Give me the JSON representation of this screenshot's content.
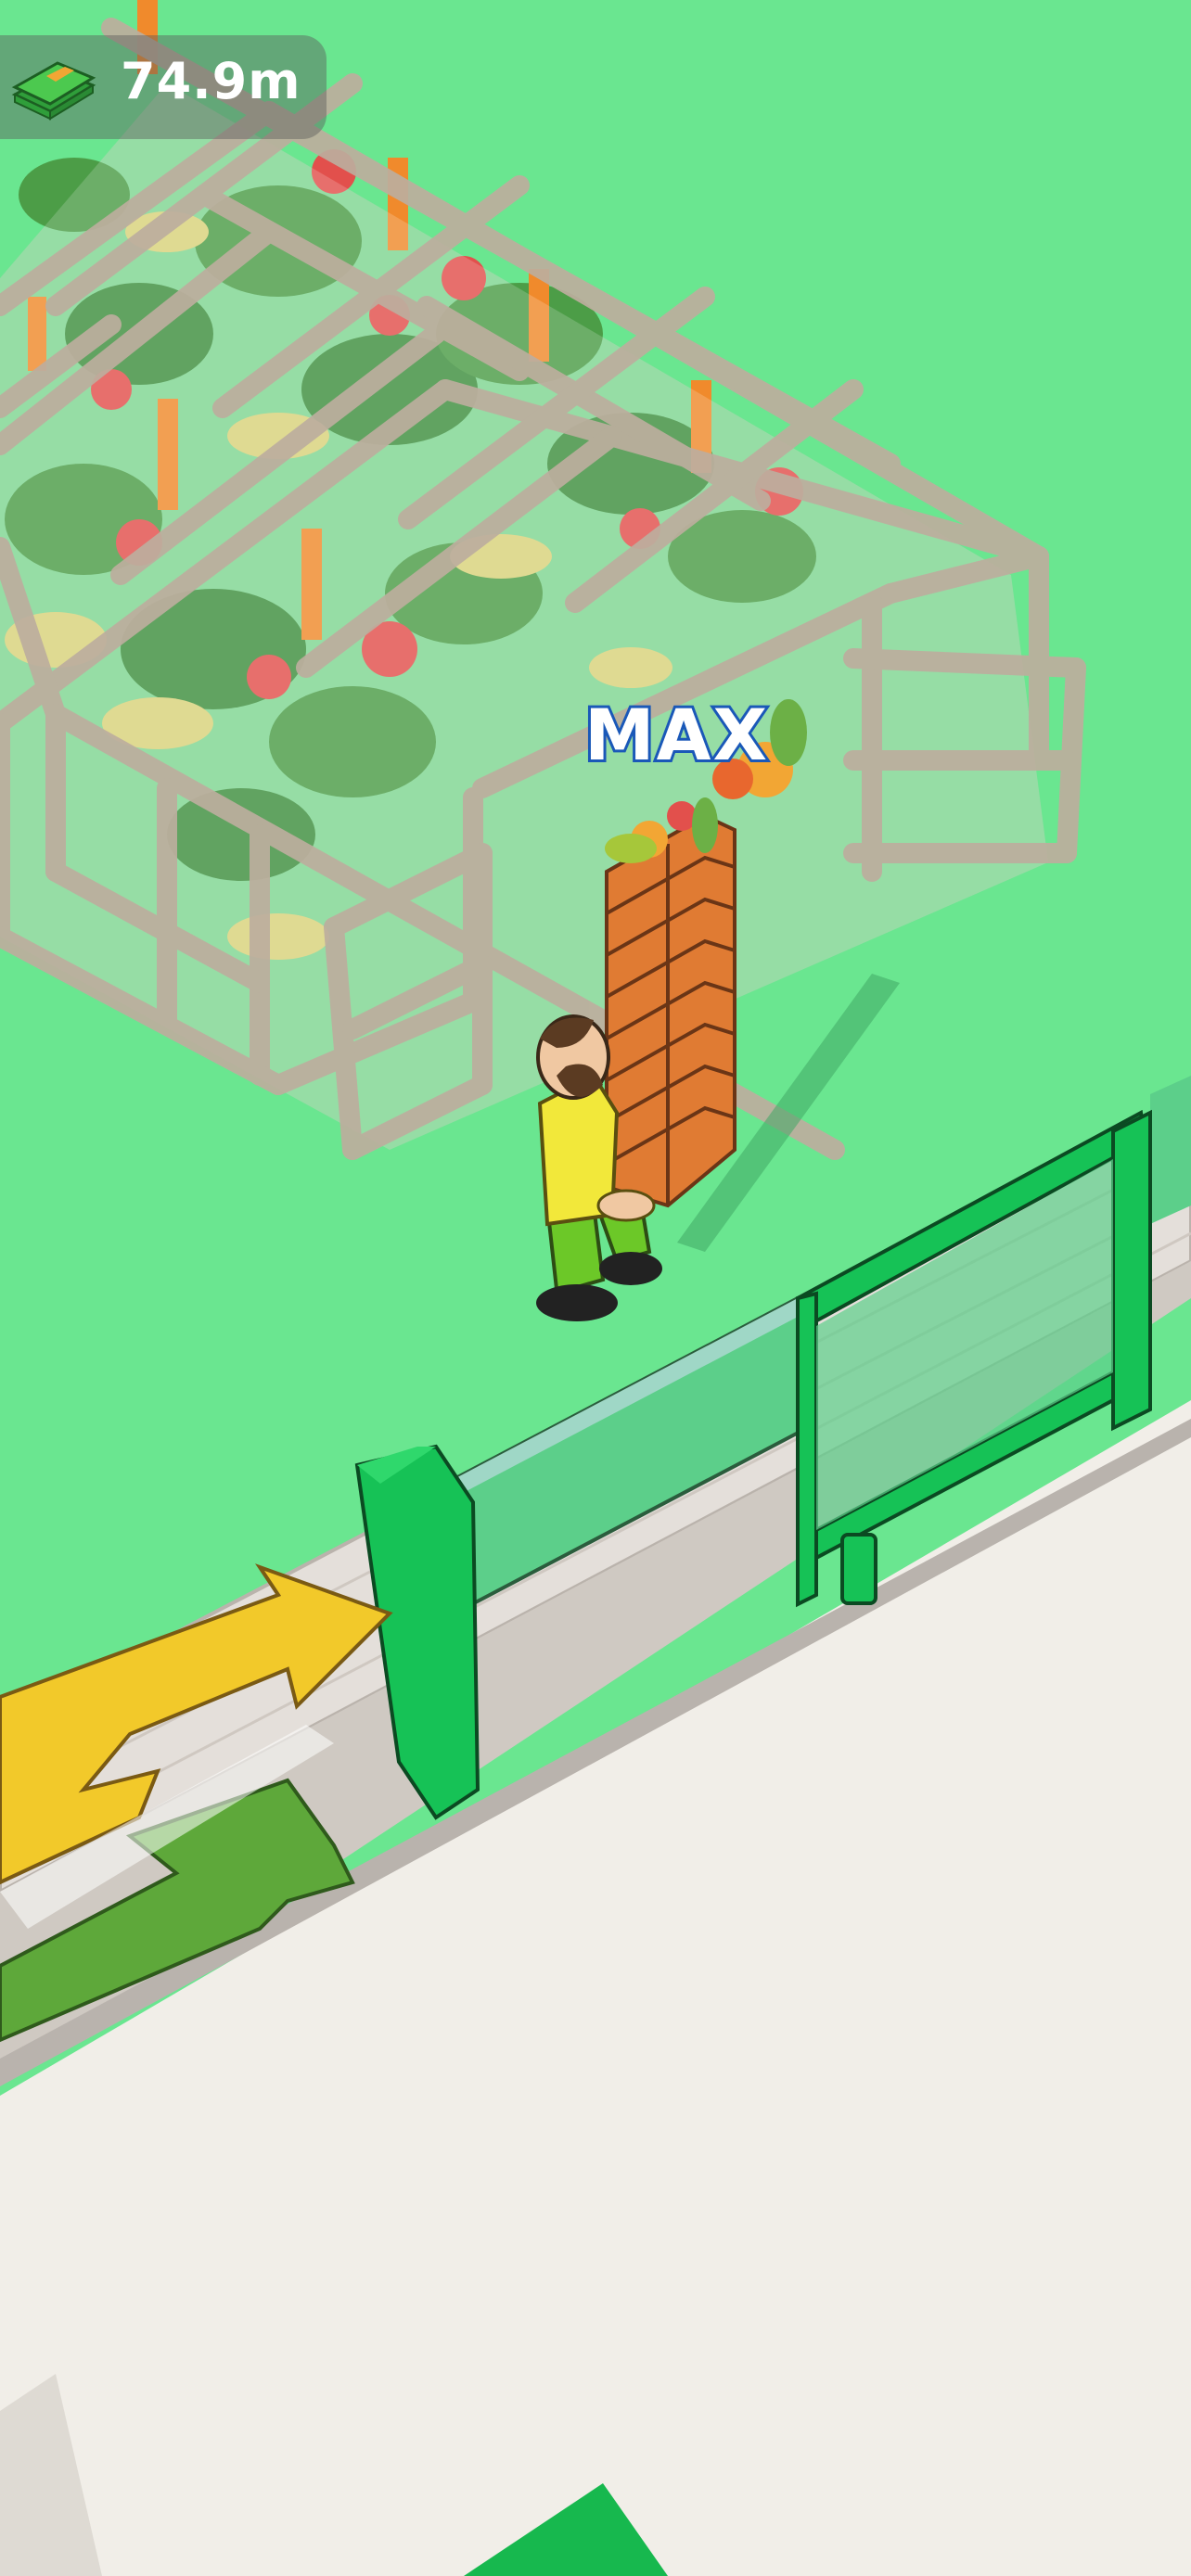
{
  "hud": {
    "cash_icon": "cash-stack-icon",
    "cash_amount": "74.9m"
  },
  "world": {
    "carry_label": "MAX",
    "character_icon": "farmer-character",
    "crate_count": 8,
    "greenhouse_icon": "greenhouse",
    "arrows_icon": "recycle-arrows-icon"
  },
  "colors": {
    "grass": "#6ae690",
    "floor": "#f1eee8",
    "frame": "#bdae9e",
    "wall_green": "#16c256",
    "shirt": "#f2e83a",
    "pants": "#6cc828",
    "crate": "#e07b33",
    "arrow_yellow": "#f2c92a",
    "arrow_green": "#5ea83a"
  }
}
